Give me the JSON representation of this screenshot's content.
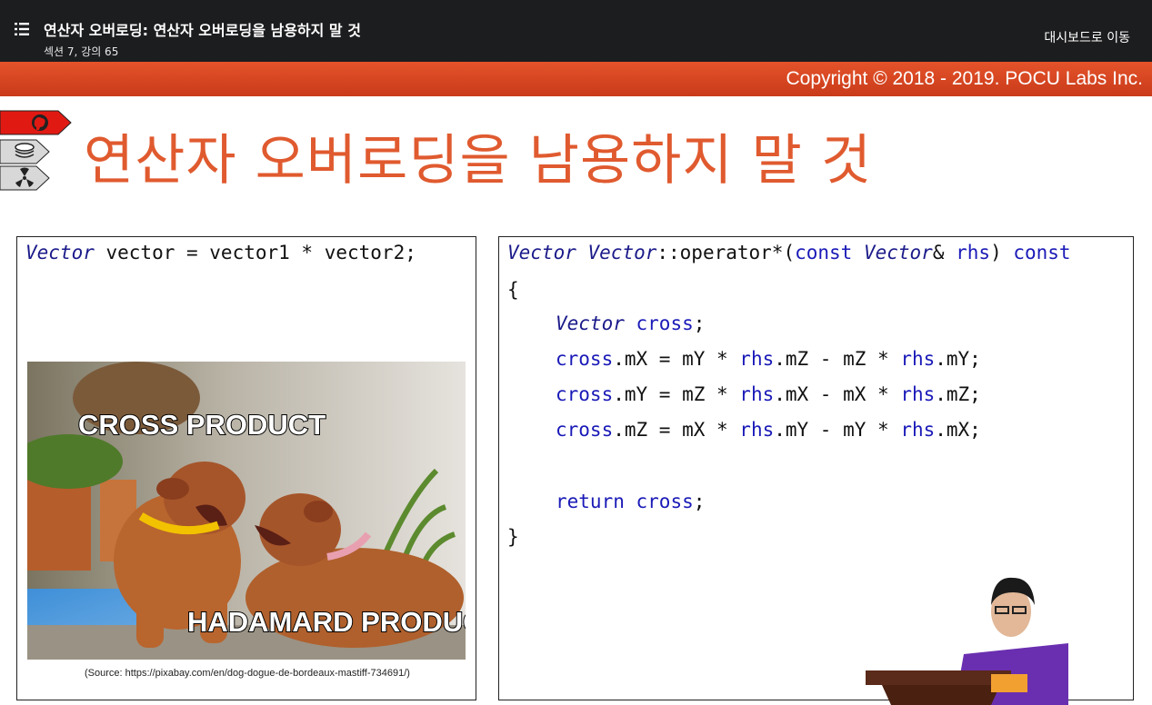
{
  "header": {
    "title": "연산자 오버로딩: 연산자 오버로딩을 남용하지 말 것",
    "subtitle": "섹션 7, 강의 65",
    "dashboard_link": "대시보드로 이동"
  },
  "slide": {
    "copyright": "Copyright © 2018 - 2019. POCU Labs Inc.",
    "title": "연산자 오버로딩을 남용하지 말 것",
    "left_code": {
      "type1": "Vector",
      "rest": " vector = vector1 * vector2;"
    },
    "image": {
      "top_label": "CROSS PRODUCT",
      "bottom_label": "HADAMARD PRODUCT",
      "caption": "(Source: https://pixabay.com/en/dog-dogue-de-bordeaux-mastiff-734691/)"
    },
    "right_code": {
      "l1_type": "Vector",
      "l1_class": "Vector",
      "l1_op": "::operator*(",
      "l1_const": "const",
      "l1_type2": "Vector",
      "l1_ref": "& ",
      "l1_rhs": "rhs",
      "l1_end": ") ",
      "l1_const2": "const",
      "l2": "{",
      "l3_type": "Vector",
      "l3_var": "cross",
      "l3_end": ";",
      "l4_var": "cross",
      "l4_mid": ".mX = mY * ",
      "l4_rhs1": "rhs",
      "l4_mid2": ".mZ - mZ * ",
      "l4_rhs2": "rhs",
      "l4_end": ".mY;",
      "l5_var": "cross",
      "l5_mid": ".mY = mZ * ",
      "l5_rhs1": "rhs",
      "l5_mid2": ".mX - mX * ",
      "l5_rhs2": "rhs",
      "l5_end": ".mZ;",
      "l6_var": "cross",
      "l6_mid": ".mZ = mX * ",
      "l6_rhs1": "rhs",
      "l6_mid2": ".mY - mY * ",
      "l6_rhs2": "rhs",
      "l6_end": ".mX;",
      "l7_kw": "return",
      "l7_var": "cross",
      "l7_end": ";",
      "l8": "}"
    }
  },
  "colors": {
    "accent": "#e05a2f",
    "topbar": "#1c1d1f",
    "keyword": "#1a1ab8"
  }
}
